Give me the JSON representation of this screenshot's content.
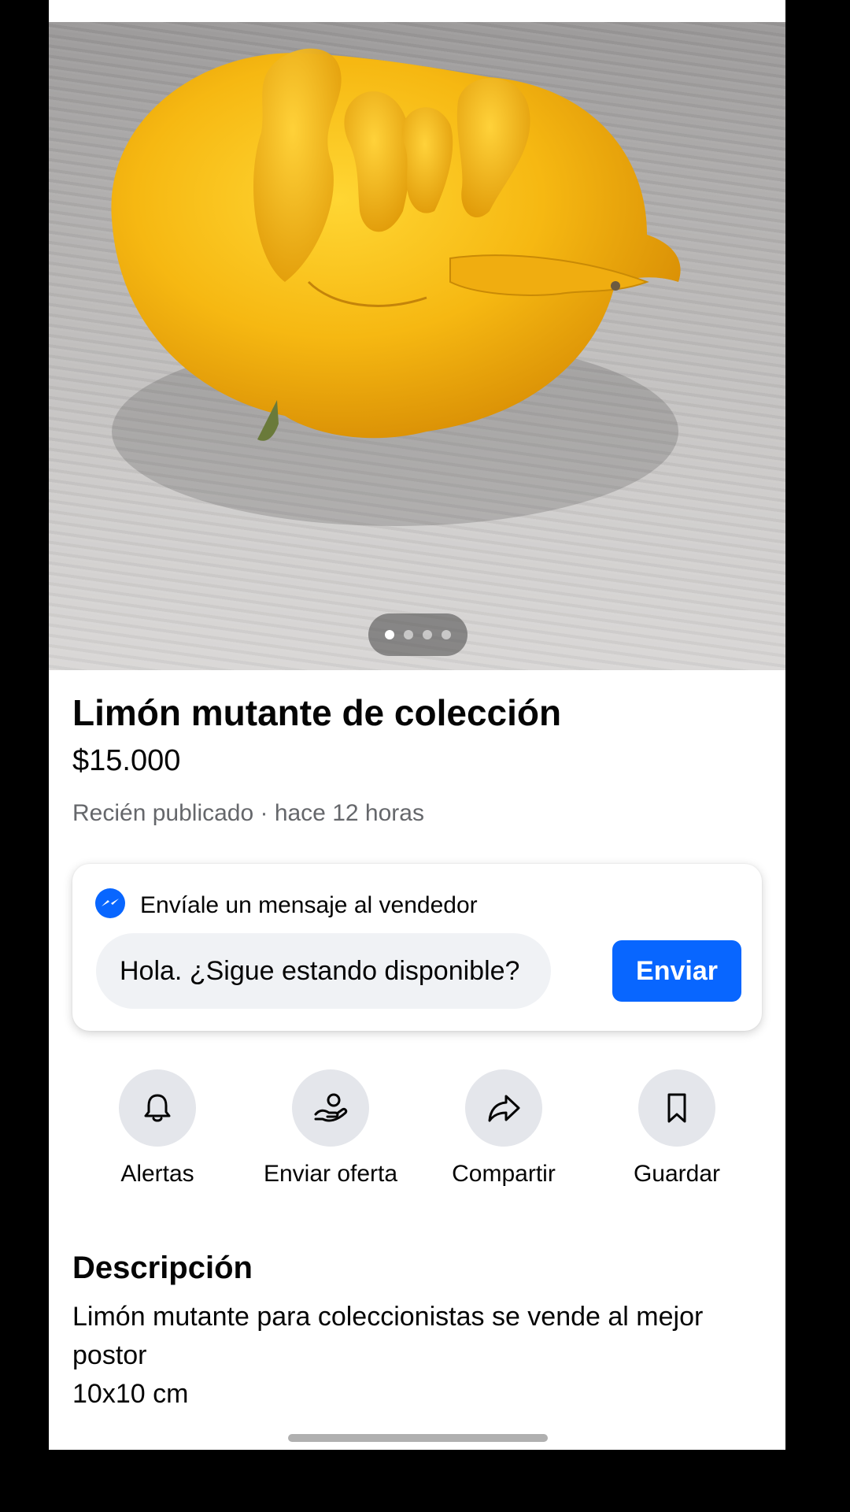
{
  "listing": {
    "image_indicator": {
      "count": 4,
      "active_index": 0
    },
    "title": "Limón mutante de colección",
    "price": "$15.000",
    "posted": "Recién publicado · hace 12 horas"
  },
  "message_card": {
    "heading": "Envíale un mensaje al vendedor",
    "input_value": "Hola. ¿Sigue estando disponible?",
    "send_label": "Enviar",
    "accent_color": "#0866ff"
  },
  "actions": [
    {
      "label": "Alertas",
      "icon": "bell-icon"
    },
    {
      "label": "Enviar oferta",
      "icon": "offer-hand-icon"
    },
    {
      "label": "Compartir",
      "icon": "share-arrow-icon"
    },
    {
      "label": "Guardar",
      "icon": "bookmark-icon"
    }
  ],
  "description": {
    "heading": "Descripción",
    "text": "Limón mutante para coleccionistas se vende al mejor postor\n10x10 cm"
  }
}
